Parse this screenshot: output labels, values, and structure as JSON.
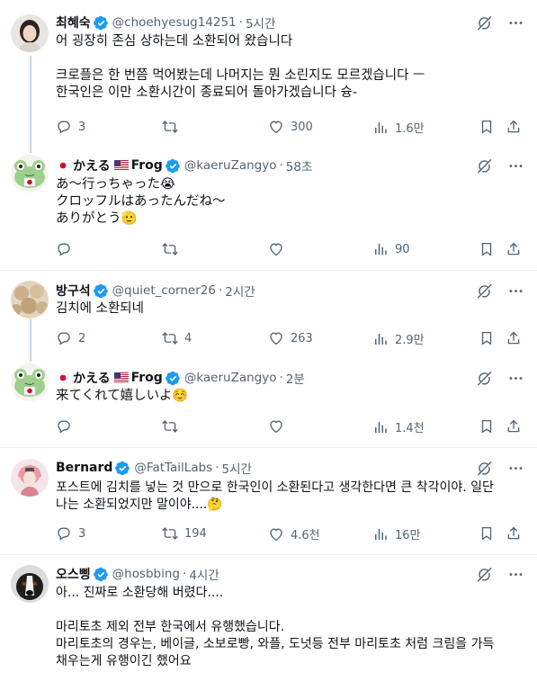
{
  "tweets": [
    {
      "name": "최혜숙",
      "handle": "@choehyesug14251",
      "time": "5시간",
      "lines": [
        "어 굉장히 존심 상하는데 소환되어 왔습니다",
        "",
        "크로플은 한 번쯤 먹어봤는데 나머지는 뭔 소린지도 모르겠습니다 ㅡ",
        "한국인은 이만 소환시간이 종료되어 돌아가겠습니다 슝-"
      ],
      "replies": "3",
      "reposts": "",
      "likes": "300",
      "views": "1.6만"
    },
    {
      "name_prefix": "かえる",
      "name_suffix": "Frog",
      "handle": "@kaeruZangyo",
      "time": "58초",
      "lines": [
        "あ〜行っちゃった😭",
        "クロッフルはあったんだね〜",
        "ありがとう🫡"
      ],
      "replies": "",
      "reposts": "",
      "likes": "",
      "views": "90"
    },
    {
      "name": "방구석",
      "handle": "@quiet_corner26",
      "time": "2시간",
      "lines": [
        "김치에 소환되네"
      ],
      "replies": "2",
      "reposts": "4",
      "likes": "263",
      "views": "2.9만"
    },
    {
      "name_prefix": "かえる",
      "name_suffix": "Frog",
      "handle": "@kaeruZangyo",
      "time": "2분",
      "lines": [
        "来てくれて嬉しいよ☺️"
      ],
      "replies": "",
      "reposts": "",
      "likes": "",
      "views": "1.4천"
    },
    {
      "name": "Bernard",
      "handle": "@FatTailLabs",
      "time": "5시간",
      "lines": [
        "포스트에 김치를 넣는 것 만으로 한국인이 소환된다고 생각한다면 큰 착각이야. 일단",
        "나는 소환되었지만 말이야....🤔"
      ],
      "replies": "3",
      "reposts": "194",
      "likes": "4.6천",
      "views": "16만"
    },
    {
      "name": "오스삥",
      "handle": "@hosbbing",
      "time": "4시간",
      "lines": [
        "아... 진짜로 소환당해 버렸다....",
        "",
        "마리토초 제외 전부 한국에서 유행했습니다.",
        "마리토초의 경우는, 베이글, 소보로빵, 와플, 도넛등 전부 마리토초 처럼 크림을 가득",
        "채우는게 유행이긴 했어요"
      ]
    }
  ],
  "separator": "·",
  "colors": {
    "verified": "#1d9bf0",
    "muted": "#536471",
    "text": "#0f1419",
    "divider": "#eff3f4"
  }
}
